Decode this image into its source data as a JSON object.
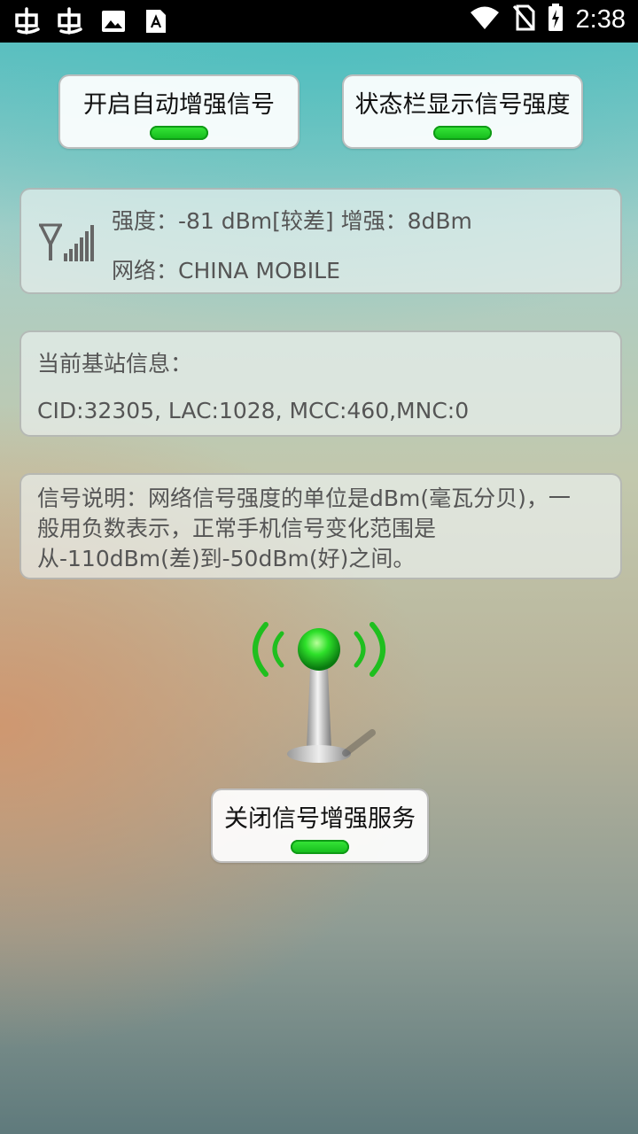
{
  "status_bar": {
    "time": "2:38",
    "left_icons": [
      "app-icon",
      "app-icon",
      "image-icon",
      "font-a-icon"
    ],
    "right_icons": [
      "wifi-icon",
      "no-sim-icon",
      "battery-charging-icon"
    ]
  },
  "toggles": {
    "auto_boost_label": "开启自动增强信号",
    "statusbar_display_label": "状态栏显示信号强度"
  },
  "signal_card": {
    "strength_line": "强度：-81 dBm[较差]  增强：8dBm",
    "network_line": "网络：CHINA MOBILE"
  },
  "base_station": {
    "title": "当前基站信息：",
    "detail": "CID:32305, LAC:1028, MCC:460,MNC:0"
  },
  "description": {
    "text": "信号说明：网络信号强度的单位是dBm(毫瓦分贝)，一般用负数表示，正常手机信号变化范围是从-110dBm(差)到-50dBm(好)之间。"
  },
  "service_toggle": {
    "label": "关闭信号增强服务"
  },
  "colors": {
    "accent_green": "#12b81a",
    "status_bar": "#000000"
  }
}
